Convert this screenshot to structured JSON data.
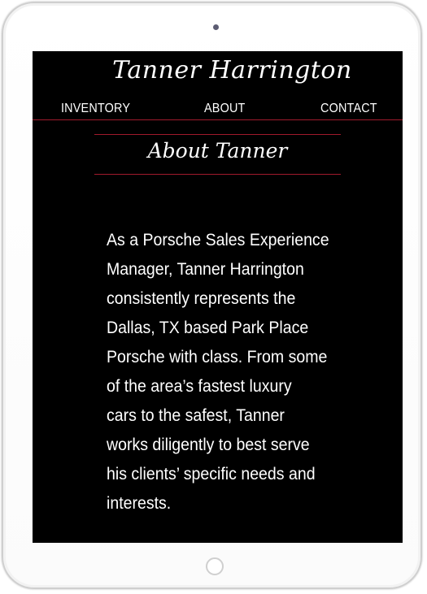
{
  "site": {
    "title": "Tanner Harrington"
  },
  "nav": {
    "items": [
      "INVENTORY",
      "ABOUT",
      "CONTACT"
    ]
  },
  "about": {
    "heading": "About Tanner",
    "lines": [
      "As a Porsche Sales Experience",
      "Manager, Tanner Harrington",
      "consistently represents the",
      "Dallas, TX based Park Place",
      "Porsche with class. From some",
      "of the area’s fastest luxury",
      "cars to the safest, Tanner",
      "works diligently to best serve",
      "his clients’ specific needs and",
      "interests."
    ]
  },
  "colors": {
    "background": "#000000",
    "text": "#ffffff",
    "accent_line": "#a01a2c",
    "device_frame": "#cfcfcf"
  }
}
